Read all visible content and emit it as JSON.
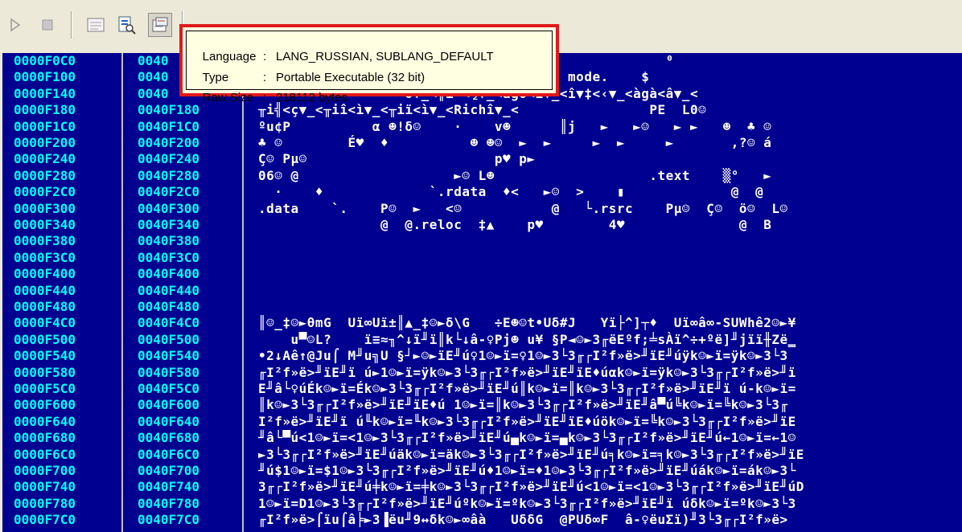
{
  "toolbar": {
    "buttons": [
      {
        "icon": "play-icon",
        "glyph": "▷"
      },
      {
        "icon": "stop-icon",
        "glyph": "■"
      },
      {
        "icon": "hex-view-icon",
        "glyph": "▤"
      },
      {
        "icon": "resource-icon",
        "glyph": "🔍"
      },
      {
        "icon": "info-icon",
        "glyph": "📄"
      }
    ]
  },
  "tooltip": {
    "rows": [
      {
        "key": "Language",
        "value": "LANG_RUSSIAN, SUBLANG_DEFAULT"
      },
      {
        "key": "Type",
        "value": "Portable Executable (32 bit)"
      },
      {
        "key": "Raw Size",
        "value": "218112 bytes"
      }
    ]
  },
  "dump": {
    "rows": [
      {
        "addr": "0000F0C0",
        "va": "0040",
        "text": "                                                  ⁰"
      },
      {
        "addr": "0000F100",
        "va": "0040",
        "text": "                  annot be run in DOS mode.    $"
      },
      {
        "addr": "0000F140",
        "va": "0040",
        "text": "                  σ▼_<╥i╨<½▼_<àgò<ì▼_<î▼‡<‹▼_<àgà<â▼_<"
      },
      {
        "addr": "0000F180",
        "va": "0040F180",
        "text": "╥i╣<ç▼_<╥iî<ì▼_<╥iï<ì▼_<Richî▼_<                PE  L0☺"
      },
      {
        "addr": "0000F1C0",
        "va": "0040F1C0",
        "text": "ºu¢P          α ☻!δ☺    ·    v☻      ║j   ►   ►☺   ► ►   ☻  ♣ ☺"
      },
      {
        "addr": "0000F200",
        "va": "0040F200",
        "text": "♣ ☺        É♥  ♦          ☻ ☻☺  ►  ►     ►  ►     ►       ,?☺ á"
      },
      {
        "addr": "0000F240",
        "va": "0040F240",
        "text": "Ç☺ Pµ☺                       p♥ p►"
      },
      {
        "addr": "0000F280",
        "va": "0040F280",
        "text": "06☺ @                   ►☺ L☻                   .text    ▒°   ►"
      },
      {
        "addr": "0000F2C0",
        "va": "0040F2C0",
        "text": "  ·    ♦             `.rdata  ♦<   ►☺  >    ▮             @  @"
      },
      {
        "addr": "0000F300",
        "va": "0040F300",
        "text": ".data    `.    P☺  ►   <☺           @   └.rsrc    Pµ☺  Ç☺  ö☺  L☺"
      },
      {
        "addr": "0000F340",
        "va": "0040F340",
        "text": "               @  @.reloc  ‡▲    p♥        4♥              @  B"
      },
      {
        "addr": "0000F380",
        "va": "0040F380",
        "text": ""
      },
      {
        "addr": "0000F3C0",
        "va": "0040F3C0",
        "text": ""
      },
      {
        "addr": "0000F400",
        "va": "0040F400",
        "text": ""
      },
      {
        "addr": "0000F440",
        "va": "0040F440",
        "text": ""
      },
      {
        "addr": "0000F480",
        "va": "0040F480",
        "text": ""
      },
      {
        "addr": "0000F4C0",
        "va": "0040F4C0",
        "text": "║☺_‡☺►θmG  Uï∞Uï±║▲_‡☺►δ\\G   ÷E☻☺t•Uδ#J   Yï├^]┬♦  Uï∞â∞-SUWhê2☺►¥"
      },
      {
        "addr": "0000F500",
        "va": "0040F500",
        "text": "    u▀☺L?    ï≡≈╖^↓ï╜ï║k└↓â-♀Pj☻ u¥ §P◄☺►3╓ëEºf;╧sÀï^÷+ºë]╜jïï╫Zë‗"
      },
      {
        "addr": "0000F540",
        "va": "0040F540",
        "text": "•2↓Aê↑@Ju⌠ M╜u╗U §┘►☺►ïE╜ú♀1☺►ï=♀1☺►3└3╓┌I²f»ë>╜ïE╜úÿk☺►ï=ÿk☺►3└3"
      },
      {
        "addr": "0000F580",
        "va": "0040F580",
        "text": "╓I²f»ë>╜ïE╜ï ú►1☺►ï=ÿk☺►3└3╓┌I²f»ë>╜ïE╜ïE♦úαk☺►ï=ÿk☺►3└3╓┌I²f»ë>╜ï"
      },
      {
        "addr": "0000F5C0",
        "va": "0040F5C0",
        "text": "E╜â└♀úÉk☺►ï=Ék☺►3└3╓┌I²f»ë>╜ïE╜ú║k☺►ï=║k☺►3└3╓┌I²f»ë>╜ïE╜ï ú-k☺►ï="
      },
      {
        "addr": "0000F600",
        "va": "0040F600",
        "text": "║k☺►3└3╓┌I²f»ë>╜ïE╜ïE♦ú 1☺►ï=║k☺►3└3╓┌I²f»ë>╜ïE╜â▀ú╚k☺►ï=╚k☺►3└3╓"
      },
      {
        "addr": "0000F640",
        "va": "0040F640",
        "text": "I²f»ë>╜ïE╜ï ú╙k☺►ï=╙k☺►3└3╓┌I²f»ë>╜ïE╜ïE♦úök☺►ï=╚k☺►3└3╓┌I²f»ë>╜ïE"
      },
      {
        "addr": "0000F680",
        "va": "0040F680",
        "text": "╜â└▀ú<1☺►ï=<1☺►3└3╓┌I²f»ë>╜ïE╜ú▄k☺►ï=▄k☺►3└3╓┌I²f»ë>╜ïE╜ú←1☺►ï=←1☺"
      },
      {
        "addr": "0000F6C0",
        "va": "0040F6C0",
        "text": "►3└3╓┌I²f»ë>╜ïE╜úäk☺►ï=äk☺►3└3╓┌I²f»ë>╜ïE╜ú╕k☺►ï=╕k☺►3└3╓┌I²f»ë>╜ïE"
      },
      {
        "addr": "0000F700",
        "va": "0040F700",
        "text": "╜ú$1☺►ï=$1☺►3└3╓┌I²f»ë>╜ïE╜ú♦1☺►ï=♦1☺►3└3╓┌I²f»ë>╜ïE╜úák☺►ï=ák☺►3└"
      },
      {
        "addr": "0000F740",
        "va": "0040F740",
        "text": "3╓┌I²f»ë>╜ïE╜ú╪k☺►ï=╪k☺►3└3╓┌I²f»ë>╜ïE╜ú<1☺►ï=<1☺►3└3╓┌I²f»ë>╜ïE╜úD"
      },
      {
        "addr": "0000F780",
        "va": "0040F780",
        "text": "1☺►ï=D1☺►3└3╓┌I²f»ë>╜ïE╜úºk☺►ï=ºk☺►3└3╓┌I²f»ë>╜ïE╜ï úδk☺►ï=ºk☺►3└3"
      },
      {
        "addr": "0000F7C0",
        "va": "0040F7C0",
        "text": "╓I²f»ë>⌠ïu⌠â╞►3▐ëu╜9↔δk☺►∞âà   UδδG  @PUδ∞F  â-♀ëuΣï)╜3└3╓┌I²f»ë>"
      }
    ]
  }
}
